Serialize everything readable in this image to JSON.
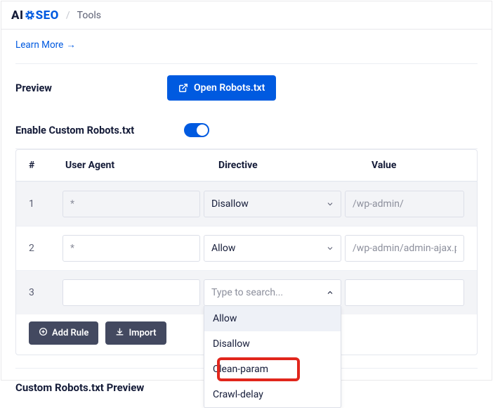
{
  "header": {
    "logo_pre": "AI",
    "logo_post": "SE",
    "crumb_sep": "/",
    "crumb": "Tools"
  },
  "learn": {
    "label": "Learn More",
    "arrow": "→"
  },
  "preview": {
    "label": "Preview",
    "button": "Open Robots.txt"
  },
  "enable": {
    "label": "Enable Custom Robots.txt"
  },
  "table": {
    "head_idx": "#",
    "head_agent": "User Agent",
    "head_dir": "Directive",
    "head_val": "Value",
    "rows": [
      {
        "idx": "1",
        "agent_ph": "*",
        "dir": "Disallow",
        "val_ph": "/wp-admin/"
      },
      {
        "idx": "2",
        "agent_ph": "*",
        "dir": "Allow",
        "val_ph": "/wp-admin/admin-ajax.php"
      },
      {
        "idx": "3",
        "agent_ph": "",
        "dir_ph": "Type to search...",
        "val_ph": ""
      }
    ],
    "dropdown": [
      "Allow",
      "Disallow",
      "Clean-param",
      "Crawl-delay"
    ]
  },
  "actions": {
    "add": "Add Rule",
    "import": "Import"
  },
  "custom_preview": {
    "title": "Custom Robots.txt Preview"
  }
}
